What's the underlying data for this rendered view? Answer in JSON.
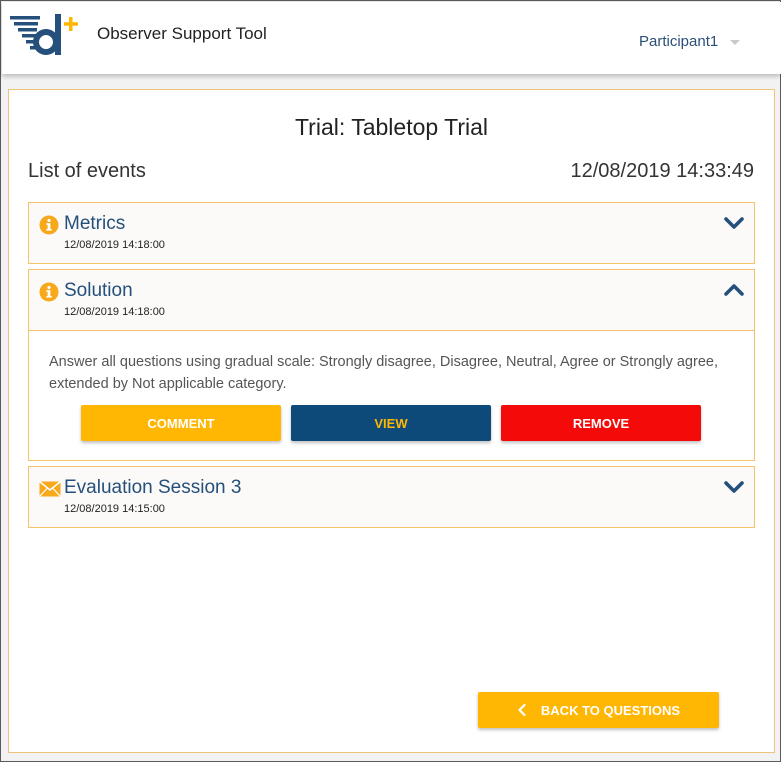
{
  "app": {
    "title": "Observer Support Tool",
    "logo_icon": "d-plus-logo"
  },
  "user_menu": {
    "label": "Participant1",
    "icon": "caret-down-icon"
  },
  "page": {
    "trial_title": "Trial: Tabletop Trial",
    "list_title": "List of events",
    "current_time": "12/08/2019 14:33:49"
  },
  "events": [
    {
      "title": "Metrics",
      "date": "12/08/2019 14:18:00",
      "icon": "info-icon",
      "expanded": false
    },
    {
      "title": "Solution",
      "date": "12/08/2019 14:18:00",
      "icon": "info-icon",
      "expanded": true,
      "description": "Answer all questions using gradual scale: Strongly disagree, Disagree, Neutral, Agree or Strongly agree, extended by Not applicable category.",
      "actions": {
        "comment": "COMMENT",
        "view": "VIEW",
        "remove": "REMOVE"
      }
    },
    {
      "title": "Evaluation Session 3",
      "date": "12/08/2019 14:15:00",
      "icon": "envelope-icon",
      "expanded": false
    }
  ],
  "footer": {
    "back_label": "BACK TO QUESTIONS",
    "back_icon": "chevron-left-icon"
  },
  "colors": {
    "accent": "#ffb703",
    "primary": "#0d4a7a",
    "danger": "#f50a0a",
    "title_blue": "#25507c",
    "border": "#f4c46a"
  }
}
